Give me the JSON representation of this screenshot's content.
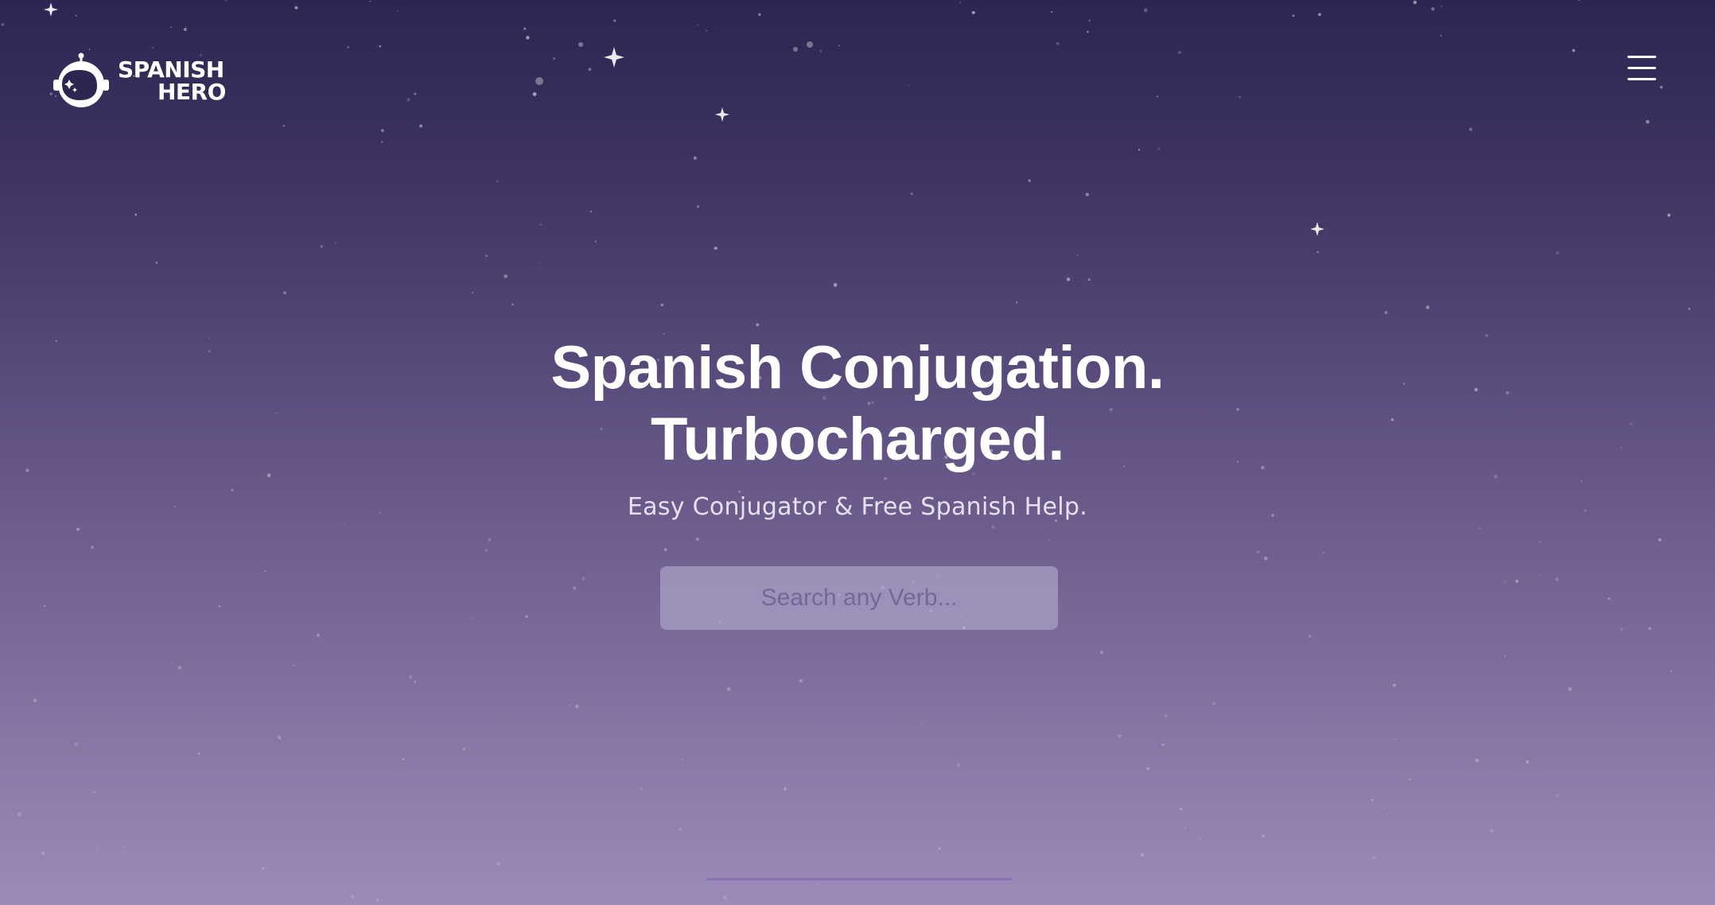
{
  "brand": {
    "line1": "SPANISH",
    "line2": "HERO"
  },
  "nav": {
    "menu_icon": "hamburger-menu-icon"
  },
  "hero": {
    "title_line1": "Spanish Conjugation.",
    "title_line2": "Turbocharged.",
    "subtitle": "Easy Conjugator & Free Spanish Help."
  },
  "search": {
    "placeholder": "Search any Verb..."
  },
  "colors": {
    "background_top": "#2d2552",
    "background_bottom": "#9c8ab8",
    "text": "#ffffff"
  }
}
